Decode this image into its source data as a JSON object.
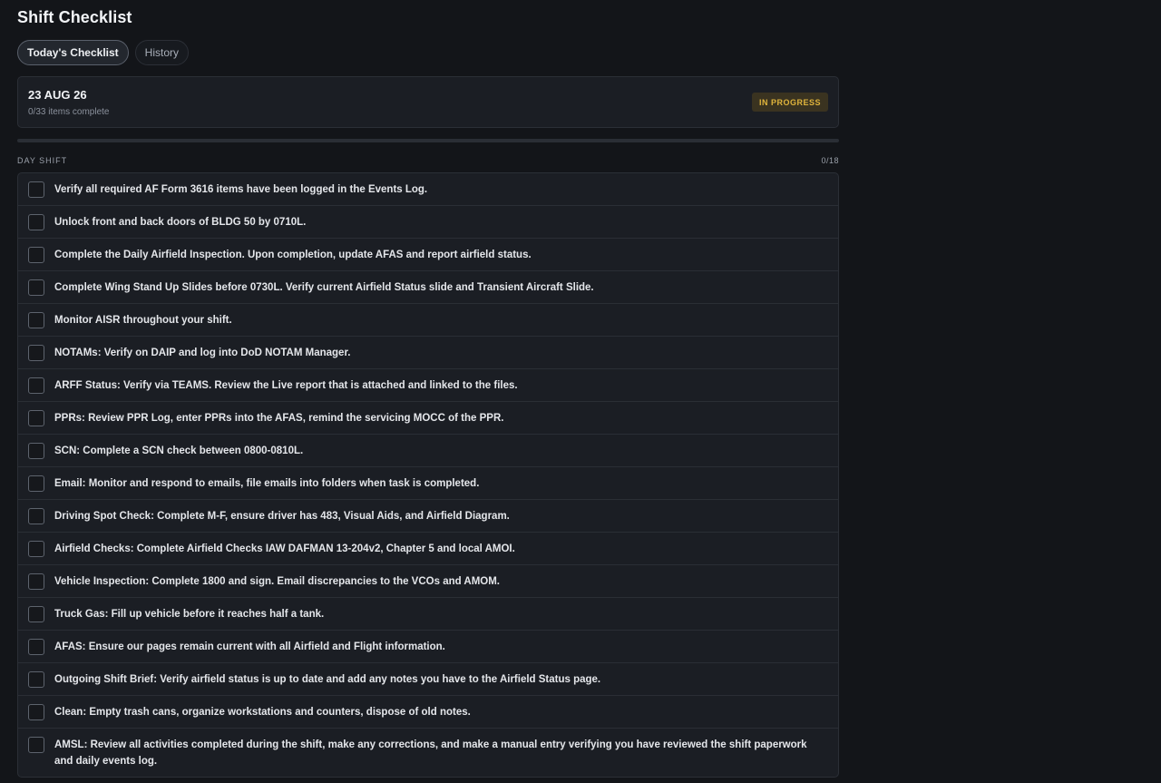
{
  "page": {
    "title": "Shift Checklist"
  },
  "tabs": [
    {
      "label": "Today's Checklist",
      "active": true
    },
    {
      "label": "History",
      "active": false
    }
  ],
  "summary": {
    "date": "23 AUG 26",
    "count_text": "0/33 items complete",
    "status": "IN PROGRESS",
    "progress_fraction": 0
  },
  "colors": {
    "status_badge_text": "#e0b43c",
    "status_badge_bg": "#3a3320",
    "progress_fill": "#4f8cf0"
  },
  "section": {
    "title": "DAY SHIFT",
    "count": "0/18"
  },
  "items": [
    {
      "text": "Verify all required AF Form 3616 items have been logged in the Events Log.",
      "checked": false
    },
    {
      "text": "Unlock front and back doors of BLDG 50 by 0710L.",
      "checked": false
    },
    {
      "text": "Complete the Daily Airfield Inspection. Upon completion, update AFAS and report airfield status.",
      "checked": false
    },
    {
      "text": "Complete Wing Stand Up Slides before 0730L. Verify current Airfield Status slide and Transient Aircraft Slide.",
      "checked": false
    },
    {
      "text": "Monitor AISR throughout your shift.",
      "checked": false
    },
    {
      "text": "NOTAMs: Verify on DAIP and log into DoD NOTAM Manager.",
      "checked": false
    },
    {
      "text": "ARFF Status: Verify via TEAMS. Review the Live report that is attached and linked to the files.",
      "checked": false
    },
    {
      "text": "PPRs: Review PPR Log, enter PPRs into the AFAS, remind the servicing MOCC of the PPR.",
      "checked": false
    },
    {
      "text": "SCN: Complete a SCN check between 0800-0810L.",
      "checked": false
    },
    {
      "text": "Email: Monitor and respond to emails, file emails into folders when task is completed.",
      "checked": false
    },
    {
      "text": "Driving Spot Check: Complete M-F, ensure driver has 483, Visual Aids, and Airfield Diagram.",
      "checked": false
    },
    {
      "text": "Airfield Checks: Complete Airfield Checks IAW DAFMAN 13-204v2, Chapter 5 and local AMOI.",
      "checked": false
    },
    {
      "text": "Vehicle Inspection: Complete 1800 and sign. Email discrepancies to the VCOs and AMOM.",
      "checked": false
    },
    {
      "text": "Truck Gas: Fill up vehicle before it reaches half a tank.",
      "checked": false
    },
    {
      "text": "AFAS: Ensure our pages remain current with all Airfield and Flight information.",
      "checked": false
    },
    {
      "text": "Outgoing Shift Brief: Verify airfield status is up to date and add any notes you have to the Airfield Status page.",
      "checked": false
    },
    {
      "text": "Clean: Empty trash cans, organize workstations and counters, dispose of old notes.",
      "checked": false
    },
    {
      "text": "AMSL: Review all activities completed during the shift, make any corrections, and make a manual entry verifying you have reviewed the shift paperwork and daily events log.",
      "checked": false
    }
  ]
}
